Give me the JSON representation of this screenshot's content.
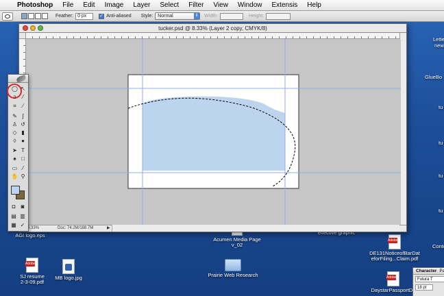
{
  "menubar": {
    "app": "Photoshop",
    "items": [
      "File",
      "Edit",
      "Image",
      "Layer",
      "Select",
      "Filter",
      "View",
      "Window",
      "Extensis",
      "Help"
    ]
  },
  "options": {
    "feather_label": "Feather:",
    "feather_value": "0 px",
    "antialiased_label": "Anti-aliased",
    "style_label": "Style:",
    "style_value": "Normal",
    "width_label": "Width:",
    "height_label": "Height:"
  },
  "document": {
    "title": "tucker.psd @ 8.33% (Layer 2 copy, CMYK/8)",
    "zoom": "8.33%",
    "doc_size": "Doc: 74.2M/188.7M",
    "ruler_numbers": [
      "10",
      "8",
      "6",
      "4",
      "2",
      "0",
      "2",
      "4",
      "6",
      "8",
      "10",
      "12",
      "14",
      "16",
      "18",
      "20",
      "22",
      "24",
      "26",
      "28",
      "30"
    ]
  },
  "colors": {
    "foreground": "#bcd4ee",
    "background": "#7c6a3a",
    "shape_fill": "#bcd4ee",
    "guide": "#8eaee8",
    "highlight_ring": "#d9262b"
  },
  "desktop": {
    "icons": [
      {
        "name": "SJ resume 2-3-09.pdf",
        "type": "pdf"
      },
      {
        "name": "MB logo.jpg",
        "type": "jpg"
      },
      {
        "name": "AGI logo.eps",
        "type": "eps"
      },
      {
        "name": "Acumen Media Page v_02",
        "type": "doc"
      },
      {
        "name": "Prairie Web Research",
        "type": "folder"
      },
      {
        "name": "effective graphic",
        "type": "doc"
      },
      {
        "name": "DE131NoticeofBarDateforFiling...Claim.pdf",
        "type": "pdf"
      },
      {
        "name": "DaystarPassportDir",
        "type": "pdf"
      }
    ],
    "icon_labels": {
      "sj": [
        "SJ resume",
        "2-3-09.pdf"
      ],
      "mb": "MB logo.jpg",
      "agi": "AGI logo.eps",
      "acumen": [
        "Acumen Media Page",
        "v_02"
      ],
      "prairie": "Prairie Web Research",
      "effective": "effective graphic",
      "de131": [
        "DE131NoticeofBarDat",
        "eforFiling...Claim.pdf"
      ],
      "daystar": "DaystarPassportDir"
    },
    "edge_labels": [
      "Lette",
      "news",
      "GlueBo",
      "tu",
      "tu",
      "tu",
      "tu",
      "Conte"
    ]
  },
  "character_panel": {
    "tab": "Character",
    "tab2": "Pa",
    "font": "Futura T",
    "size": "18 pt"
  }
}
